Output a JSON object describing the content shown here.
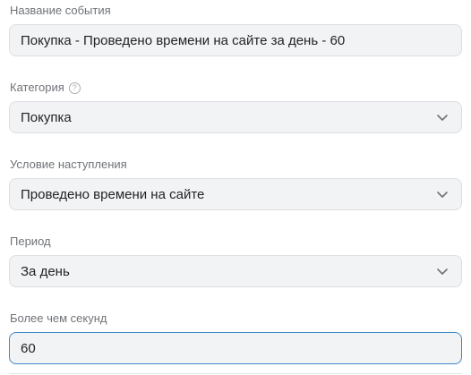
{
  "fields": {
    "event_name": {
      "label": "Название события",
      "value": "Покупка - Проведено времени на сайте за день - 60"
    },
    "category": {
      "label": "Категория",
      "value": "Покупка",
      "help_icon": "help-circle-icon"
    },
    "condition": {
      "label": "Условие наступления",
      "value": "Проведено времени на сайте"
    },
    "period": {
      "label": "Период",
      "value": "За день"
    },
    "seconds": {
      "label": "Более чем секунд",
      "value": "60"
    }
  },
  "colors": {
    "label": "#6f7378",
    "field_bg": "#f2f3f4",
    "field_border": "#dcdee1",
    "focus_border": "#3e88c9",
    "text": "#1f2225"
  }
}
